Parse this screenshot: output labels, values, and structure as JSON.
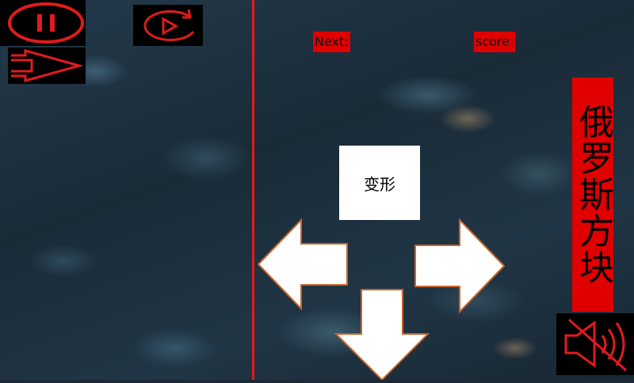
{
  "game": {
    "next_label": "Next:",
    "score_label": "score:",
    "title": "俄罗斯方块",
    "rotate_label": "变形"
  },
  "icons": {
    "pause": "pause-icon",
    "replay": "replay-icon",
    "exit": "exit-icon",
    "mute": "mute-icon",
    "left": "left-arrow-icon",
    "right": "right-arrow-icon",
    "down": "down-arrow-icon"
  },
  "colors": {
    "accent_red": "#e11b1b",
    "label_red": "#e00000",
    "control_white": "#ffffff",
    "control_outline": "#c7642a"
  }
}
